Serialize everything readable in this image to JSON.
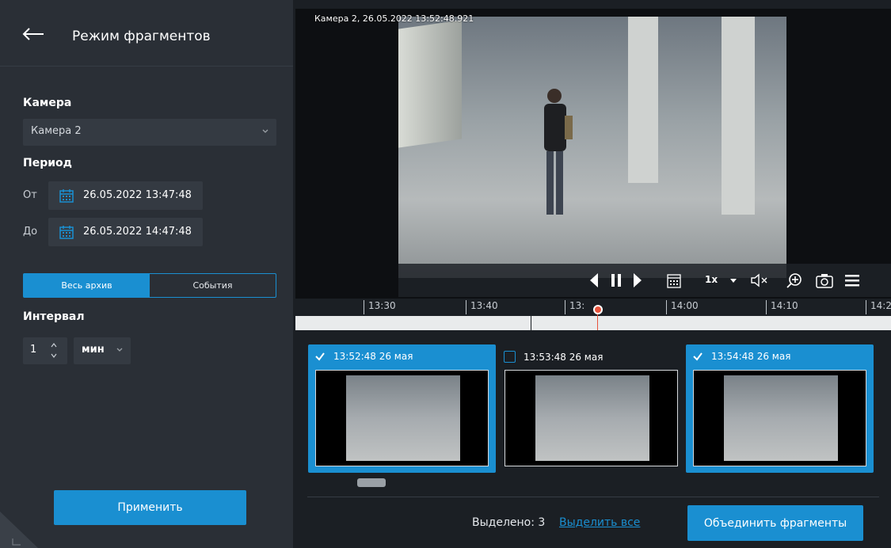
{
  "sidebar": {
    "title": "Режим фрагментов",
    "camera_label": "Камера",
    "camera_value": "Камера 2",
    "period_label": "Период",
    "from_label": "От",
    "from_value": "26.05.2022  13:47:48",
    "to_label": "До",
    "to_value": "26.05.2022  14:47:48",
    "tabs": [
      {
        "label": "Весь архив",
        "active": true
      },
      {
        "label": "События",
        "active": false
      }
    ],
    "interval_label": "Интервал",
    "interval_value": "1",
    "interval_unit": "мин",
    "apply_label": "Применить"
  },
  "video": {
    "overlay": "Камера 2, 26.05.2022 13:52:48.921",
    "speed": "1x"
  },
  "timeline": {
    "ticks": [
      "13:30",
      "13:40",
      "13:",
      "14:00",
      "14:10",
      "14:2"
    ]
  },
  "fragments": [
    {
      "label": "13:52:48 26 мая",
      "selected": true
    },
    {
      "label": "13:53:48 26 мая",
      "selected": false
    },
    {
      "label": "13:54:48 26 мая",
      "selected": true
    }
  ],
  "footer": {
    "selected_text": "Выделено: 3",
    "select_all": "Выделить все",
    "merge_label": "Объединить фрагменты"
  },
  "colors": {
    "accent": "#1a8fd1",
    "playhead": "#e8533c"
  }
}
